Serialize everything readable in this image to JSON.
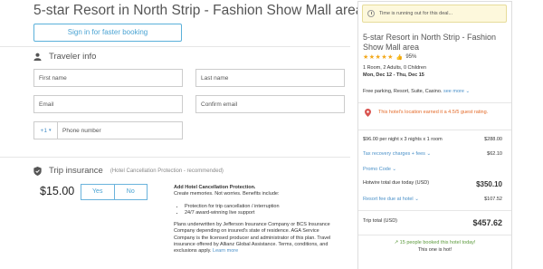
{
  "page": {
    "title": "5-star Resort in North Strip - Fashion Show Mall area",
    "signin_label": "Sign in for faster booking"
  },
  "traveler": {
    "heading": "Traveler info",
    "first_name_placeholder": "First name",
    "last_name_placeholder": "Last name",
    "email_placeholder": "Email",
    "confirm_email_placeholder": "Confirm email",
    "phone_code": "+1",
    "phone_placeholder": "Phone number"
  },
  "insurance": {
    "heading": "Trip insurance",
    "subheading": "(Hotel Cancellation Protection - recommended)",
    "price": "$15.00",
    "yes_label": "Yes",
    "no_label": "No",
    "title": "Add Hotel Cancellation Protection.",
    "tagline": "Create memories. Not worries. Benefits include:",
    "benefits": [
      "Protection for trip cancellation / interruption",
      "24/7 award-winning live support"
    ],
    "fine_print": "Plans underwritten by Jefferson Insurance Company or BCS Insurance Company depending on insured's state of residence. AGA Service Company is the licensed producer and administrator of this plan. Travel insurance offered by Allianz Global Assistance. Terms, conditions, and exclusions apply.",
    "learn_more": "Learn more"
  },
  "summary": {
    "deal_banner": "Time is running out for this deal...",
    "hotel_name": "5-star Resort in North Strip - Fashion Show Mall area",
    "stars": "★★★★★",
    "rating_percent": "95%",
    "room_line": "1 Room, 2 Adults, 0 Children",
    "dates": "Mon, Dec 12 - Thu, Dec 15",
    "amenities": "Free parking, Resort, Suite, Casino.",
    "see_more": "see more",
    "location_text": "This hotel's location earned it a 4.5/5 guest rating.",
    "nightly_label": "$96.00 per night x 3 nights x 1 room",
    "nightly_value": "$288.00",
    "tax_label": "Tax recovery charges + fees",
    "tax_value": "$62.10",
    "promo_label": "Promo Code",
    "hotwire_label": "Hotwire total due today (USD)",
    "hotwire_value": "$350.10",
    "resort_fee_label": "Resort fee due at hotel",
    "resort_fee_value": "$107.52",
    "trip_total_label": "Trip total (USD)",
    "trip_total_value": "$457.62",
    "booked_today": "15 people booked this hotel today!",
    "last_one": "This one is hot!"
  },
  "colors": {
    "accent_blue": "#4aa3d3",
    "warning_orange": "#e46b2a",
    "success_green": "#5c9a3c",
    "star_gold": "#f3a81b"
  }
}
